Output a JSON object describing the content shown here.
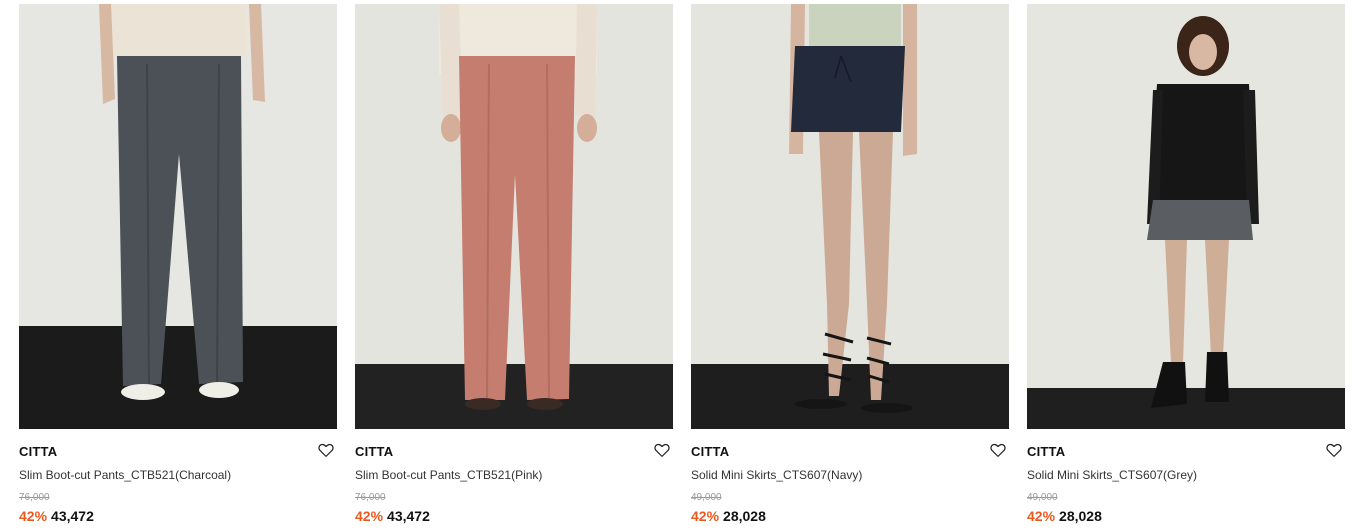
{
  "products": [
    {
      "brand": "CITTA",
      "name": "Slim Boot-cut Pants_CTB521(Charcoal)",
      "original_price": "76,000",
      "discount": "42%",
      "sale_price": "43,472",
      "image": "model-charcoal-bootcut-pants"
    },
    {
      "brand": "CITTA",
      "name": "Slim Boot-cut Pants_CTB521(Pink)",
      "original_price": "76,000",
      "discount": "42%",
      "sale_price": "43,472",
      "image": "model-pink-bootcut-pants"
    },
    {
      "brand": "CITTA",
      "name": "Solid Mini Skirts_CTS607(Navy)",
      "original_price": "49,000",
      "discount": "42%",
      "sale_price": "28,028",
      "image": "model-navy-mini-skirt"
    },
    {
      "brand": "CITTA",
      "name": "Solid Mini Skirts_CTS607(Grey)",
      "original_price": "49,000",
      "discount": "42%",
      "sale_price": "28,028",
      "image": "model-grey-mini-skirt"
    }
  ],
  "icons": {
    "wishlist": "heart-outline-icon"
  },
  "colors": {
    "discount": "#e85a1f",
    "original_price": "#9a9a9a",
    "text": "#111111"
  }
}
